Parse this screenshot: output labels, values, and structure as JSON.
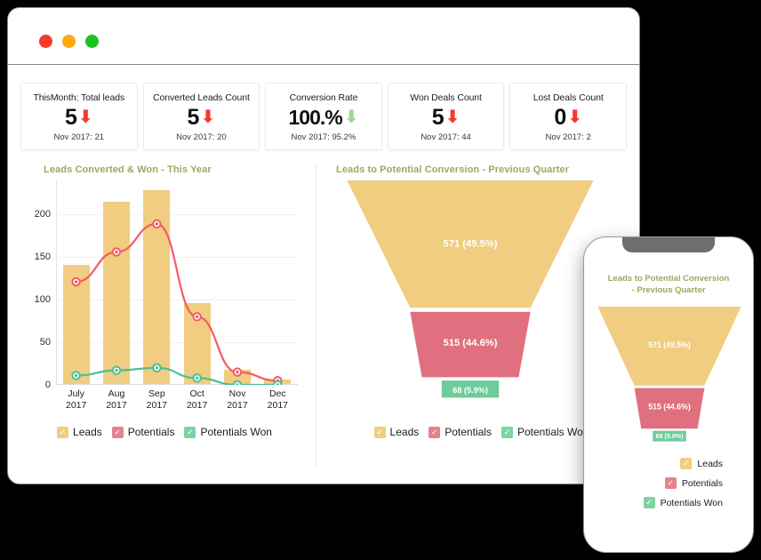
{
  "window": {
    "traffic_lights": [
      {
        "name": "close",
        "color": "#f93a2f"
      },
      {
        "name": "minimize",
        "color": "#ffa90a"
      },
      {
        "name": "maximize",
        "color": "#1dc121"
      }
    ]
  },
  "kpis": [
    {
      "title": "ThisMonth: Total leads",
      "value": "5",
      "trend": "down",
      "trend_color": "#f4392c",
      "sub": "Nov 2017: 21"
    },
    {
      "title": "Converted Leads Count",
      "value": "5",
      "trend": "down",
      "trend_color": "#f4392c",
      "sub": "Nov 2017: 20"
    },
    {
      "title": "Conversion Rate",
      "value": "100.%",
      "trend": "down",
      "trend_color": "#9cd98e",
      "sub": "Nov 2017: 95.2%"
    },
    {
      "title": "Won Deals Count",
      "value": "5",
      "trend": "down",
      "trend_color": "#f4392c",
      "sub": "Nov 2017: 44"
    },
    {
      "title": "Lost Deals Count",
      "value": "0",
      "trend": "down",
      "trend_color": "#f4392c",
      "sub": "Nov 2017: 2"
    }
  ],
  "legend": [
    {
      "label": "Leads",
      "color": "#f0cd80"
    },
    {
      "label": "Potentials",
      "color": "#e8818e"
    },
    {
      "label": "Potentials Won",
      "color": "#7ed3a4"
    }
  ],
  "panels": {
    "left_title": "Leads Converted & Won - This Year",
    "right_title": "Leads to Potential Conversion - Previous Quarter"
  },
  "phone": {
    "title_line1": "Leads to Potential Conversion",
    "title_line2": "- Previous Quarter"
  },
  "chart_data": [
    {
      "type": "bar",
      "title": "Leads Converted & Won - This Year",
      "categories": [
        "July\n2017",
        "Aug\n2017",
        "Sep\n2017",
        "Oct\n2017",
        "Nov\n2017",
        "Dec\n2017"
      ],
      "category_lines": [
        [
          "July",
          "2017"
        ],
        [
          "Aug",
          "2017"
        ],
        [
          "Sep",
          "2017"
        ],
        [
          "Oct",
          "2017"
        ],
        [
          "Nov",
          "2017"
        ],
        [
          "Dec",
          "2017"
        ]
      ],
      "xlabel": "",
      "ylabel": "",
      "ylim": [
        0,
        240
      ],
      "yticks": [
        0,
        50,
        100,
        150,
        200
      ],
      "grid": true,
      "legend_position": "bottom",
      "series": [
        {
          "name": "Leads",
          "kind": "bar",
          "color": "#f0cd80",
          "values": [
            140,
            214,
            228,
            95,
            17,
            5
          ]
        },
        {
          "name": "Potentials",
          "kind": "line",
          "color": "#f45b63",
          "values": [
            121,
            156,
            189,
            80,
            15,
            5
          ]
        },
        {
          "name": "Potentials Won",
          "kind": "line",
          "color": "#4cbf95",
          "values": [
            11,
            17,
            20,
            8,
            0,
            0
          ]
        }
      ]
    },
    {
      "type": "funnel",
      "title": "Leads to Potential Conversion - Previous Quarter",
      "stages": [
        {
          "name": "Leads",
          "value": 571,
          "percent": 49.5,
          "label": "571 (49.5%)",
          "color": "#f0cd80"
        },
        {
          "name": "Potentials",
          "value": 515,
          "percent": 44.6,
          "label": "515 (44.6%)",
          "color": "#e0707f"
        },
        {
          "name": "Potentials Won",
          "value": 68,
          "percent": 5.9,
          "label": "68 (5.9%)",
          "color": "#6ecb9a"
        }
      ]
    }
  ]
}
